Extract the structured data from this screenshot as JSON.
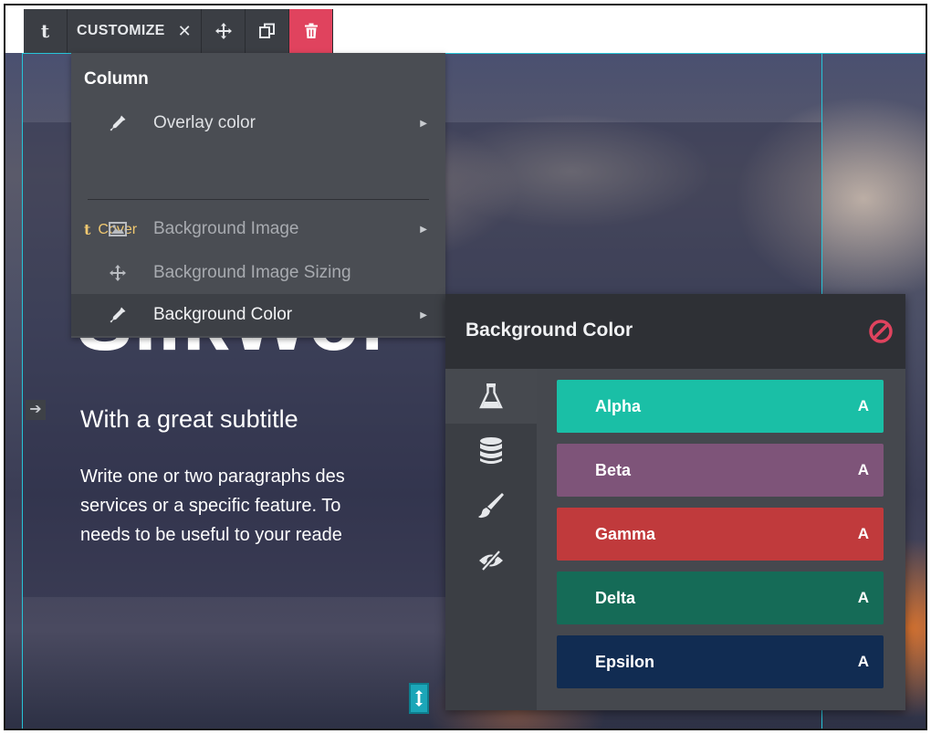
{
  "toolbar": {
    "customize_label": "CUSTOMIZE",
    "close_glyph": "✕",
    "icons": [
      "cover-t-icon",
      "move-icon",
      "duplicate-icon",
      "trash-icon"
    ]
  },
  "menu": {
    "column_heading": "Column",
    "overlay_color": "Overlay color",
    "cover_label": "Cover",
    "background_image": "Background Image",
    "background_image_sizing": "Background Image Sizing",
    "background_color": "Background Color"
  },
  "hero": {
    "title_fragment": "SilkWor",
    "subtitle": "With a great subtitle",
    "body_lines": [
      "Write one or two paragraphs des",
      "services or a specific feature. To",
      "needs to be useful to your reade"
    ]
  },
  "panel": {
    "title": "Background Color",
    "swatches": [
      {
        "name": "Alpha",
        "letter": "A",
        "color": "#1abfa6"
      },
      {
        "name": "Beta",
        "letter": "A",
        "color": "#7e5479"
      },
      {
        "name": "Gamma",
        "letter": "A",
        "color": "#c03a3c"
      },
      {
        "name": "Delta",
        "letter": "A",
        "color": "#156b57"
      },
      {
        "name": "Epsilon",
        "letter": "A",
        "color": "#112c52"
      }
    ],
    "tabs": [
      "flask-icon",
      "database-icon",
      "brush-icon",
      "eye-slash-icon"
    ]
  },
  "colors": {
    "accent": "#27c4d8",
    "danger": "#e0435e",
    "panel_dark": "#2e3035",
    "menu_bg": "#4a4d53",
    "cover_label": "#f0c870"
  }
}
